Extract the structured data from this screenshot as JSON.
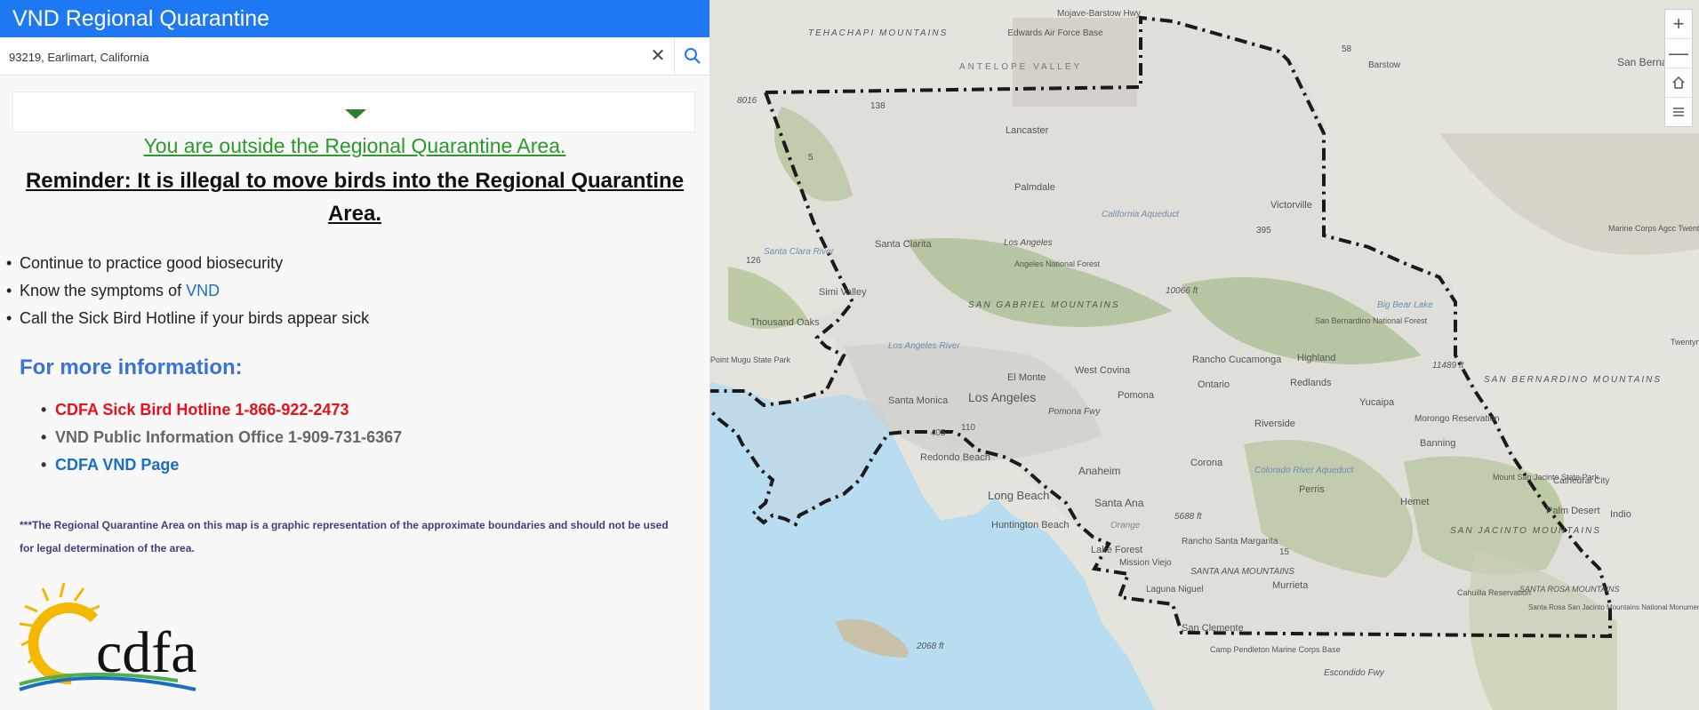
{
  "app": {
    "title": "VND Regional Quarantine"
  },
  "search": {
    "value": "93219, Earlimart, California",
    "clear_icon": "close-icon",
    "search_icon": "search-icon"
  },
  "result": {
    "status": "You are outside the Regional Quarantine Area.",
    "reminder": "Reminder: It is illegal to move birds into the Regional Quarantine Area.",
    "bullets": [
      {
        "text": "Continue to practice good biosecurity"
      },
      {
        "text": "Know the symptoms of ",
        "link": "VND"
      },
      {
        "text": "Call the Sick Bird Hotline if your birds appear sick"
      }
    ]
  },
  "more_info": {
    "heading": "For more information:",
    "items": [
      {
        "text": "CDFA Sick Bird Hotline 1-866-922-2473",
        "color": "#e8111b"
      },
      {
        "text": "VND Public Information Office 1-909-731-6367",
        "color": "#666666"
      },
      {
        "text": "CDFA VND Page",
        "color": "#1a6fc4"
      }
    ]
  },
  "disclaimer": "***The Regional Quarantine Area on this map is a graphic representation of the approximate boundaries and should not be used for legal determination of the area.",
  "logo": {
    "text": "cdfa"
  },
  "map": {
    "zoom_in": "+",
    "zoom_out": "—",
    "labels": {
      "mojave_barstow": "Mojave-Barstow Hwy",
      "edwards": "Edwards Air Force Base",
      "antelope_valley": "ANTELOPE VALLEY",
      "barstow": "Barstow",
      "san_bernardino": "San Bernardino",
      "lancaster": "Lancaster",
      "palmdale": "Palmdale",
      "victorville": "Victorville",
      "california_aqueduct": "California Aqueduct",
      "santa_clarita": "Santa Clarita",
      "los_angeles_ridge": "Los Angeles",
      "angeles_nf": "Angeles National Forest",
      "simi_valley": "Simi Valley",
      "thousand_oaks": "Thousand Oaks",
      "san_gabriel_mtns": "SAN GABRIEL MOUNTAINS",
      "elev_10066": "10066 ft",
      "big_bear": "Big Bear Lake",
      "sb_nf": "San Bernardino National Forest",
      "marine_corps": "Marine Corps Agcc Twentynine Palms",
      "twentynine": "Twentynine Palms",
      "santa_clara_river": "Santa Clara River",
      "los_angeles_river": "Los Angeles River",
      "rancho_cucamonga": "Rancho Cucamonga",
      "highland": "Highland",
      "elev_11489": "11489 ft",
      "sb_mtns": "SAN BERNARDINO MOUNTAINS",
      "west_covina": "West Covina",
      "el_monte": "El Monte",
      "ontario": "Ontario",
      "redlands": "Redlands",
      "point_mugu": "Point Mugu State Park",
      "santa_monica": "Santa Monica",
      "los_angeles": "Los Angeles",
      "pomona": "Pomona",
      "yucaipa": "Yucaipa",
      "morongo": "Morongo Reservation",
      "riverside": "Riverside",
      "banning": "Banning",
      "redondo": "Redondo Beach",
      "anaheim": "Anaheim",
      "corona": "Corona",
      "colorado_aqueduct": "Colorado River Aqueduct",
      "mt_san_jacinto": "Mount San Jacinto State Park",
      "cathedral_city": "Cathedral City",
      "long_beach": "Long Beach",
      "santa_ana": "Santa Ana",
      "perris": "Perris",
      "hemet": "Hemet",
      "palm_desert": "Palm Desert",
      "indio": "Indio",
      "elev_5688": "5688 ft",
      "orange": "Orange",
      "huntington": "Huntington Beach",
      "rancho_sm": "Rancho Santa Margarita",
      "san_jacinto_mtns": "SAN JACINTO MOUNTAINS",
      "lake_forest": "Lake Forest",
      "mission_viejo": "Mission Viejo",
      "santa_ana_mtns": "SANTA ANA MOUNTAINS",
      "murrieta": "Murrieta",
      "laguna_niguel": "Laguna Niguel",
      "santa_rosa_mtns": "SANTA ROSA MOUNTAINS",
      "cahuilla": "Cahuilla Reservation",
      "santa_rosa_nm": "Santa Rosa San Jacinto Mountains National Monument",
      "san_clemente": "San Clemente",
      "elev_2068": "2068 ft",
      "camp_pendleton": "Camp Pendleton Marine Corps Base",
      "elev_8016": "8016",
      "hwy_138": "138",
      "hwy_395": "395",
      "hwy_5": "5",
      "hwy_58": "58",
      "hwy_405": "405",
      "hwy_110": "110",
      "hwy_15": "15",
      "hwy_126": "126",
      "pomona_fwy": "Pomona Fwy",
      "escondido_fwy": "Escondido Fwy",
      "tehachapi": "TEHACHAPI MOUNTAINS"
    }
  }
}
